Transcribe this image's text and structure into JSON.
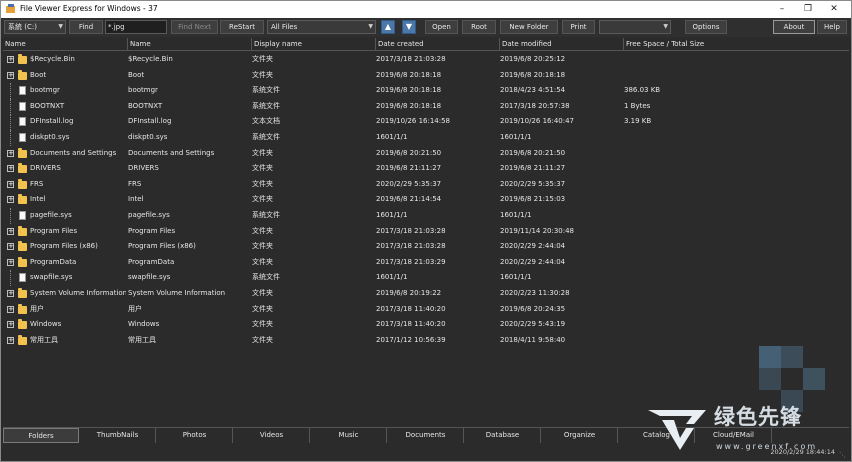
{
  "window": {
    "title": "File Viewer Express for Windows - 37"
  },
  "toolbar": {
    "drive_select": "系統 (C:)",
    "find_label": "Find",
    "find_value": "*.jpg",
    "find_next_label": "Find Next",
    "restart_label": "ReStart",
    "filter_select": "All Files",
    "open_label": "Open",
    "root_label": "Root",
    "new_folder_label": "New Folder",
    "print_label": "Print",
    "extra_select": "",
    "options_label": "Options",
    "about_label": "About",
    "help_label": "Help"
  },
  "columns": [
    "Name",
    "Name",
    "Display name",
    "Date created",
    "Date modified",
    "Free Space / Total Size"
  ],
  "rows": [
    {
      "type": "folder",
      "expand": true,
      "name": "$Recycle.Bin",
      "name2": "$Recycle.Bin",
      "display": "文件夹",
      "created": "2017/3/18 21:03:28",
      "modified": "2019/6/8 20:25:12",
      "size": ""
    },
    {
      "type": "folder",
      "expand": true,
      "name": "Boot",
      "name2": "Boot",
      "display": "文件夹",
      "created": "2019/6/8 20:18:18",
      "modified": "2019/6/8 20:18:18",
      "size": ""
    },
    {
      "type": "file",
      "expand": false,
      "name": "bootmgr",
      "name2": "bootmgr",
      "display": "系统文件",
      "created": "2019/6/8 20:18:18",
      "modified": "2018/4/23 4:51:54",
      "size": "386.03 KB"
    },
    {
      "type": "file",
      "expand": false,
      "name": "BOOTNXT",
      "name2": "BOOTNXT",
      "display": "系统文件",
      "created": "2019/6/8 20:18:18",
      "modified": "2017/3/18 20:57:38",
      "size": "1 Bytes"
    },
    {
      "type": "file",
      "expand": false,
      "name": "DFInstall.log",
      "name2": "DFInstall.log",
      "display": "文本文档",
      "created": "2019/10/26 16:14:58",
      "modified": "2019/10/26 16:40:47",
      "size": "3.19 KB"
    },
    {
      "type": "file",
      "expand": false,
      "name": "diskpt0.sys",
      "name2": "diskpt0.sys",
      "display": "系统文件",
      "created": "1601/1/1",
      "modified": "1601/1/1",
      "size": ""
    },
    {
      "type": "folder",
      "expand": true,
      "name": "Documents and Settings",
      "name2": "Documents and Settings",
      "display": "文件夹",
      "created": "2019/6/8 20:21:50",
      "modified": "2019/6/8 20:21:50",
      "size": ""
    },
    {
      "type": "folder",
      "expand": true,
      "name": "DRIVERS",
      "name2": "DRIVERS",
      "display": "文件夹",
      "created": "2019/6/8 21:11:27",
      "modified": "2019/6/8 21:11:27",
      "size": ""
    },
    {
      "type": "folder",
      "expand": true,
      "name": "FRS",
      "name2": "FRS",
      "display": "文件夹",
      "created": "2020/2/29 5:35:37",
      "modified": "2020/2/29 5:35:37",
      "size": ""
    },
    {
      "type": "folder",
      "expand": true,
      "name": "Intel",
      "name2": "Intel",
      "display": "文件夹",
      "created": "2019/6/8 21:14:54",
      "modified": "2019/6/8 21:15:03",
      "size": ""
    },
    {
      "type": "file",
      "expand": false,
      "name": "pagefile.sys",
      "name2": "pagefile.sys",
      "display": "系统文件",
      "created": "1601/1/1",
      "modified": "1601/1/1",
      "size": ""
    },
    {
      "type": "folder",
      "expand": true,
      "name": "Program Files",
      "name2": "Program Files",
      "display": "文件夹",
      "created": "2017/3/18 21:03:28",
      "modified": "2019/11/14 20:30:48",
      "size": ""
    },
    {
      "type": "folder",
      "expand": true,
      "name": "Program Files (x86)",
      "name2": "Program Files (x86)",
      "display": "文件夹",
      "created": "2017/3/18 21:03:28",
      "modified": "2020/2/29 2:44:04",
      "size": ""
    },
    {
      "type": "folder",
      "expand": true,
      "name": "ProgramData",
      "name2": "ProgramData",
      "display": "文件夹",
      "created": "2017/3/18 21:03:29",
      "modified": "2020/2/29 2:44:04",
      "size": ""
    },
    {
      "type": "file",
      "expand": false,
      "name": "swapfile.sys",
      "name2": "swapfile.sys",
      "display": "系统文件",
      "created": "1601/1/1",
      "modified": "1601/1/1",
      "size": ""
    },
    {
      "type": "folder",
      "expand": true,
      "name": "System Volume Information",
      "name2": "System Volume Information",
      "display": "文件夹",
      "created": "2019/6/8 20:19:22",
      "modified": "2020/2/23 11:30:28",
      "size": ""
    },
    {
      "type": "folder",
      "expand": true,
      "name": "用户",
      "name2": "用户",
      "display": "文件夹",
      "created": "2017/3/18 11:40:20",
      "modified": "2019/6/8 20:24:35",
      "size": ""
    },
    {
      "type": "folder",
      "expand": true,
      "name": "Windows",
      "name2": "Windows",
      "display": "文件夹",
      "created": "2017/3/18 11:40:20",
      "modified": "2020/2/29 5:43:19",
      "size": ""
    },
    {
      "type": "folder",
      "expand": true,
      "name": "常用工具",
      "name2": "常用工具",
      "display": "文件夹",
      "created": "2017/1/12 10:56:39",
      "modified": "2018/4/11 9:58:40",
      "size": ""
    }
  ],
  "tabs": [
    "Folders",
    "ThumbNails",
    "Photos",
    "Videos",
    "Music",
    "Documents",
    "Database",
    "Organize",
    "Catalog",
    "Cloud/EMail"
  ],
  "active_tab": "Folders",
  "status": {
    "datetime": "2020/2/29 18:44:14"
  },
  "watermark": {
    "brand": "绿色先锋",
    "url": "www.greenxf.com"
  },
  "colors": {
    "background": "#2b2b2b",
    "folder": "#f2c24f",
    "nav_button": "#4a78a8"
  }
}
